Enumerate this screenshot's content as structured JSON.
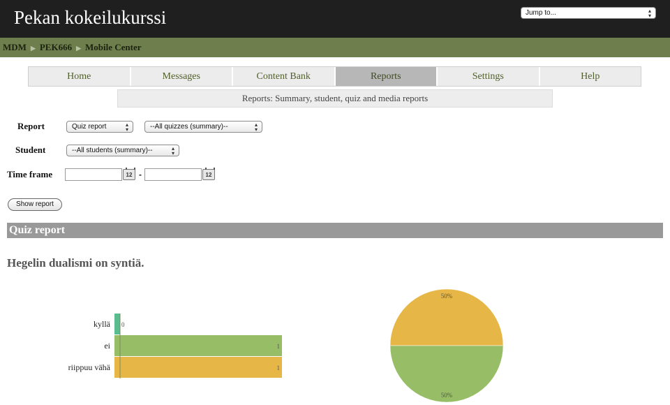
{
  "header": {
    "site_title": "Pekan kokeilukurssi",
    "jump_label": "Jump to..."
  },
  "breadcrumb": [
    "MDM",
    "PEK666",
    "Mobile Center"
  ],
  "nav": {
    "tabs": [
      "Home",
      "Messages",
      "Content Bank",
      "Reports",
      "Settings",
      "Help"
    ],
    "active": "Reports"
  },
  "subnav": {
    "label": "Reports: Summary, student, quiz and media reports"
  },
  "form": {
    "report_label": "Report",
    "report_type": "Quiz report",
    "quiz_select": "--All quizzes (summary)--",
    "student_label": "Student",
    "student_select": "--All students (summary)--",
    "timeframe_label": "Time frame",
    "date_from": "",
    "date_to": "",
    "calendar_icon_text": "12",
    "date_separator": "-",
    "show_button": "Show report"
  },
  "section_title": "Quiz report",
  "question": "Hegelin dualismi on syntiä.",
  "colors": {
    "kylla": "#5bbd8f",
    "ei": "#97bd66",
    "riippuu": "#e6b746",
    "header_bg": "#1f1f1f",
    "breadcrumb_bg": "#6e7f4d"
  },
  "chart_data": [
    {
      "type": "bar",
      "orientation": "horizontal",
      "categories": [
        "kyllä",
        "ei",
        "riippuu vähä"
      ],
      "values": [
        0,
        1,
        1
      ],
      "xlim": [
        0,
        1
      ],
      "grid": false
    },
    {
      "type": "pie",
      "labels": [
        "riippuu vähä",
        "ei"
      ],
      "values": [
        50,
        50
      ],
      "value_labels": [
        "50%",
        "50%"
      ]
    }
  ]
}
